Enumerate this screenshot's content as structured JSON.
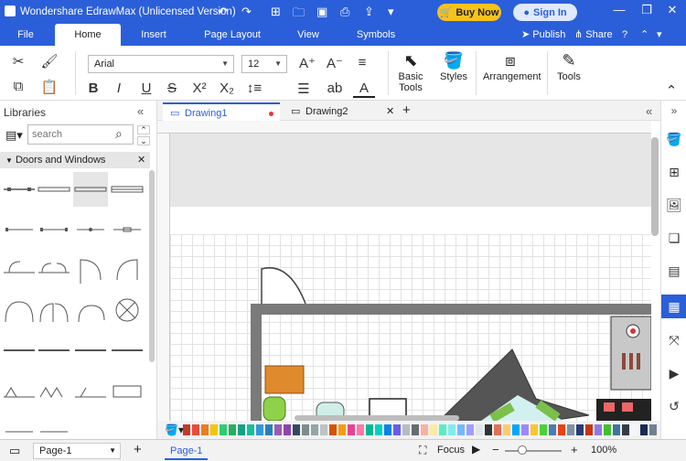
{
  "window": {
    "title": "Wondershare EdrawMax (Unlicensed Version)",
    "buy_label": "Buy Now",
    "sign_label": "Sign In"
  },
  "menu": {
    "items": [
      "File",
      "Home",
      "Insert",
      "Page Layout",
      "View",
      "Symbols"
    ],
    "publish": "Publish",
    "share": "Share"
  },
  "ribbon": {
    "font_name": "Arial",
    "font_size": "12",
    "basic_tools": "Basic Tools",
    "styles": "Styles",
    "arrangement": "Arrangement",
    "tools": "Tools"
  },
  "libraries": {
    "title": "Libraries",
    "search_placeholder": "search",
    "category": "Doors and Windows"
  },
  "tabs": [
    "Drawing1",
    "Drawing2"
  ],
  "status": {
    "page_select": "Page-1",
    "page_tab": "Page-1",
    "focus": "Focus",
    "zoom": "100%"
  },
  "colors": {
    "accent": "#2b5fd9",
    "buy": "#f7c21b"
  }
}
